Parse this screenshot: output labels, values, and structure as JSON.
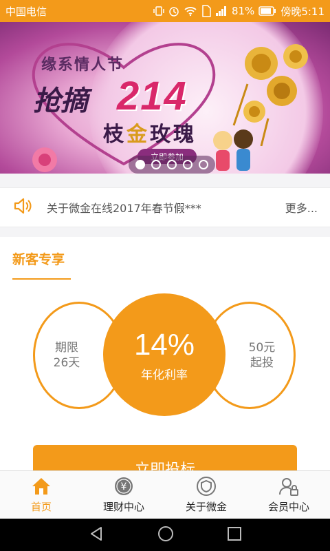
{
  "statusbar": {
    "carrier": "中国电信",
    "battery": "81%",
    "time": "傍晚5:11"
  },
  "banner": {
    "subtitle": "缘系情人节",
    "grab": "抢摘",
    "number": "214",
    "rose_pre": "枝",
    "rose_gold": "金",
    "rose_post": "玫瑰",
    "join": "立即参加",
    "slides": 5,
    "active_slide": 1
  },
  "notice": {
    "text": "关于微金在线2017年春节假***",
    "more": "更多..."
  },
  "newcustomer": {
    "title": "新客专享",
    "term_label": "期限",
    "term_value": "26天",
    "rate": "14%",
    "rate_label": "年化利率",
    "min_value": "50元",
    "min_label": "起投",
    "invest_button": "立即投标"
  },
  "nav": {
    "items": [
      {
        "label": "首页",
        "icon": "home-icon",
        "active": true
      },
      {
        "label": "理财中心",
        "icon": "yen-icon",
        "active": false
      },
      {
        "label": "关于微金",
        "icon": "shield-icon",
        "active": false
      },
      {
        "label": "会员中心",
        "icon": "user-lock-icon",
        "active": false
      }
    ]
  },
  "colors": {
    "accent": "#f39a1a",
    "banner_pink": "#d9286a"
  }
}
